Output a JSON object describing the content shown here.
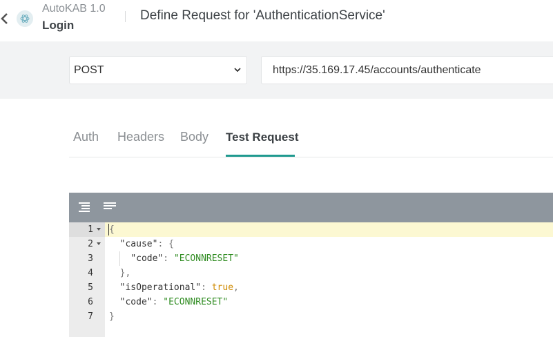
{
  "header": {
    "app_name": "AutoKAB 1.0",
    "page_name": "Login",
    "title": "Define Request for 'AuthenticationService'",
    "logo_icon": "atom-logo-icon"
  },
  "request": {
    "method": "POST",
    "url": "https://35.169.17.45/accounts/authenticate"
  },
  "tabs": [
    {
      "label": "Auth",
      "active": false
    },
    {
      "label": "Headers",
      "active": false
    },
    {
      "label": "Body",
      "active": false
    },
    {
      "label": "Test Request",
      "active": true
    }
  ],
  "editor": {
    "toolbar_icons": [
      "format-icon",
      "compact-icon"
    ],
    "lines": [
      {
        "num": "1",
        "text": "{"
      },
      {
        "num": "2",
        "text": "  \"cause\": {"
      },
      {
        "num": "3",
        "text": "    \"code\": \"ECONNRESET\""
      },
      {
        "num": "4",
        "text": "  },"
      },
      {
        "num": "5",
        "text": "  \"isOperational\": true,"
      },
      {
        "num": "6",
        "text": "  \"code\": \"ECONNRESET\""
      },
      {
        "num": "7",
        "text": "}"
      }
    ]
  },
  "colors": {
    "accent": "#1f9a8f",
    "toolbar": "#8e969e",
    "string": "#2e8b20",
    "boolean": "#cf8a00",
    "active_line": "#fcf8d2"
  }
}
